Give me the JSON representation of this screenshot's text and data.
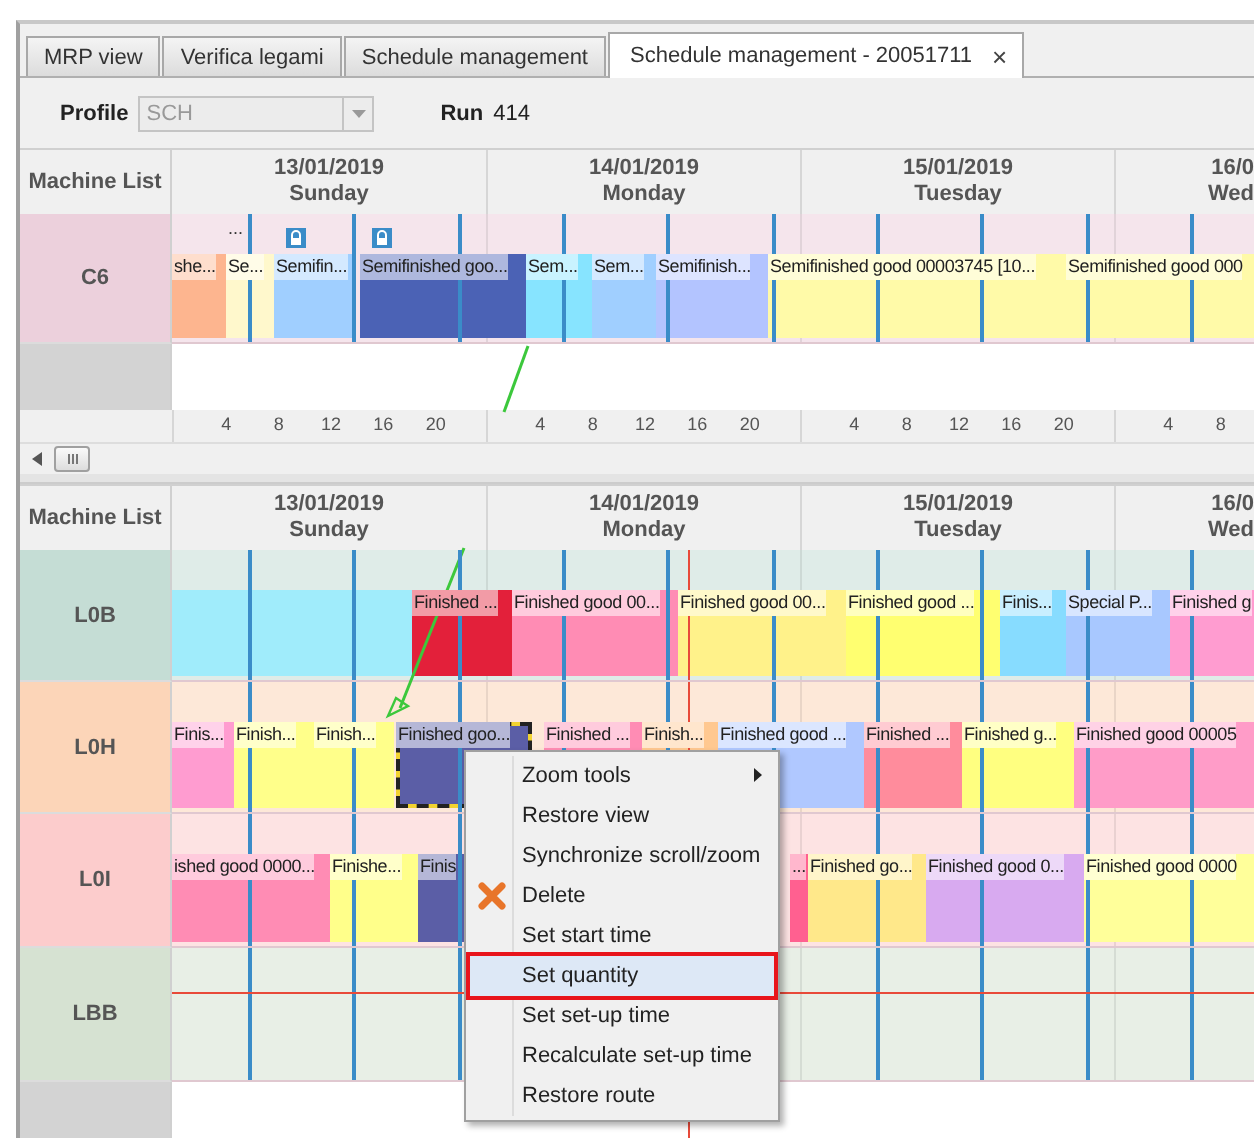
{
  "tabs": [
    {
      "label": "MRP view",
      "selected": false
    },
    {
      "label": "Verifica legami",
      "selected": false
    },
    {
      "label": "Schedule management",
      "selected": false
    },
    {
      "label": "Schedule management - 20051711",
      "selected": true,
      "close": "×"
    }
  ],
  "toolbar": {
    "profile_label": "Profile",
    "profile_value": "SCH",
    "profile_disabled": true,
    "run_label": "Run",
    "run_value": "414"
  },
  "top_schedule": {
    "header": "Machine List",
    "days": [
      {
        "date": "13/01/2019",
        "weekday": "Sunday",
        "ticks": [
          "4",
          "8",
          "12",
          "16",
          "20"
        ]
      },
      {
        "date": "14/01/2019",
        "weekday": "Monday",
        "ticks": [
          "4",
          "8",
          "12",
          "16",
          "20"
        ]
      },
      {
        "date": "15/01/2019",
        "weekday": "Tuesday",
        "ticks": [
          "4",
          "8",
          "12",
          "16",
          "20"
        ]
      },
      {
        "date": "16/0",
        "weekday": "Wed",
        "ticks": [
          "4",
          "8"
        ]
      }
    ],
    "machines": [
      {
        "name": "C6",
        "color": "#ecd0dc",
        "tasks": [
          {
            "label": "she...",
            "color": "#fdb58f",
            "selected": false,
            "locked": false
          },
          {
            "label": "Se...",
            "color": "#fff8cc",
            "selected": false,
            "locked": false,
            "note": "..."
          },
          {
            "label": "Semifin...",
            "color": "#a0cfff",
            "selected": false,
            "locked": true
          },
          {
            "label": "Semifinished goo...",
            "color": "#4b62b5",
            "selected": false,
            "locked": true
          },
          {
            "label": "Sem...",
            "color": "#87e4ff",
            "selected": false,
            "locked": false
          },
          {
            "label": "Sem...",
            "color": "#a0cfff",
            "selected": false,
            "locked": false
          },
          {
            "label": "Semifinish...",
            "color": "#b3c4ff",
            "selected": false,
            "locked": false
          },
          {
            "label": "Semifinished good 00003745 [10...",
            "color": "#fffaa8",
            "selected": false,
            "locked": false
          },
          {
            "label": "Semifinished good 000",
            "color": "#fffaa8",
            "selected": false,
            "locked": false
          }
        ]
      }
    ]
  },
  "bottom_schedule": {
    "header": "Machine List",
    "days": [
      {
        "date": "13/01/2019",
        "weekday": "Sunday"
      },
      {
        "date": "14/01/2019",
        "weekday": "Monday"
      },
      {
        "date": "15/01/2019",
        "weekday": "Tuesday"
      },
      {
        "date": "16/0",
        "weekday": "Wed"
      }
    ],
    "machines": [
      {
        "name": "L0B",
        "color": "#c5ddd5",
        "tasks": [
          {
            "color": "#a0ecfb",
            "selected": false
          },
          {
            "label": "Finished ...",
            "color": "#e3203a",
            "selected": false
          },
          {
            "label": "Finished good 00...",
            "color": "#ff8cb4",
            "selected": false
          },
          {
            "label": "Finished good 00...",
            "color": "#fff28a",
            "selected": false
          },
          {
            "label": "Finished good ...",
            "color": "#ffff70",
            "selected": false
          },
          {
            "label": "Finis...",
            "color": "#87dcff",
            "selected": false
          },
          {
            "label": "Special P...",
            "color": "#a8c8ff",
            "selected": false
          },
          {
            "label": "Finished g",
            "color": "#ff9cd0",
            "selected": false
          }
        ]
      },
      {
        "name": "L0H",
        "color": "#fcd5b8",
        "tasks": [
          {
            "label": "Finis...",
            "color": "#ff9cd0",
            "selected": false
          },
          {
            "label": "Finish...",
            "color": "#ffff8a",
            "selected": false
          },
          {
            "label": "Finish...",
            "color": "#ffff8a",
            "selected": false
          },
          {
            "label": "Finished goo...",
            "color": "#5b5ea6",
            "selected": true
          },
          {
            "label": "Finished ...",
            "color": "#ff8cb4",
            "selected": false
          },
          {
            "label": "Finish...",
            "color": "#ffc890",
            "selected": false
          },
          {
            "label": "Finished good ...",
            "color": "#b0c8ff",
            "selected": false
          },
          {
            "label": "Finished ...",
            "color": "#ff8c9c",
            "selected": false
          },
          {
            "label": "Finished g...",
            "color": "#ffff80",
            "selected": false
          },
          {
            "label": "Finished good 00005",
            "color": "#ff9cc8",
            "selected": false
          }
        ]
      },
      {
        "name": "L0I",
        "color": "#fccccc",
        "tasks": [
          {
            "label": "ished good 0000...",
            "color": "#ff8cb4",
            "selected": false
          },
          {
            "label": "Finishe...",
            "color": "#ffff8a",
            "selected": false
          },
          {
            "label": "Finis",
            "color": "#5b5ea6",
            "selected": false
          },
          {
            "label": "...",
            "color": "#ff6090",
            "selected": false
          },
          {
            "label": "Finished go...",
            "color": "#ffe88a",
            "selected": false
          },
          {
            "label": "Finished good 0...",
            "color": "#d8aaf0",
            "selected": false
          },
          {
            "label": "Finished good 0000",
            "color": "#ffff9a",
            "selected": false
          }
        ]
      },
      {
        "name": "LBB",
        "color": "#d6e2d2"
      }
    ]
  },
  "context_menu": {
    "items": [
      {
        "label": "Zoom tools",
        "kind": "submenu",
        "selected": false
      },
      {
        "label": "Restore view",
        "kind": "plain",
        "selected": false
      },
      {
        "label": "Synchronize scroll/zoom",
        "kind": "plain",
        "selected": false
      },
      {
        "label": "Delete",
        "kind": "delete",
        "selected": false
      },
      {
        "label": "Set start time",
        "kind": "plain",
        "selected": false
      },
      {
        "label": "Set quantity",
        "kind": "plain",
        "selected": true
      },
      {
        "label": "Set set-up time",
        "kind": "plain",
        "selected": false
      },
      {
        "label": "Recalculate set-up time",
        "kind": "plain",
        "selected": false
      },
      {
        "label": "Restore route",
        "kind": "plain",
        "selected": false
      }
    ]
  }
}
